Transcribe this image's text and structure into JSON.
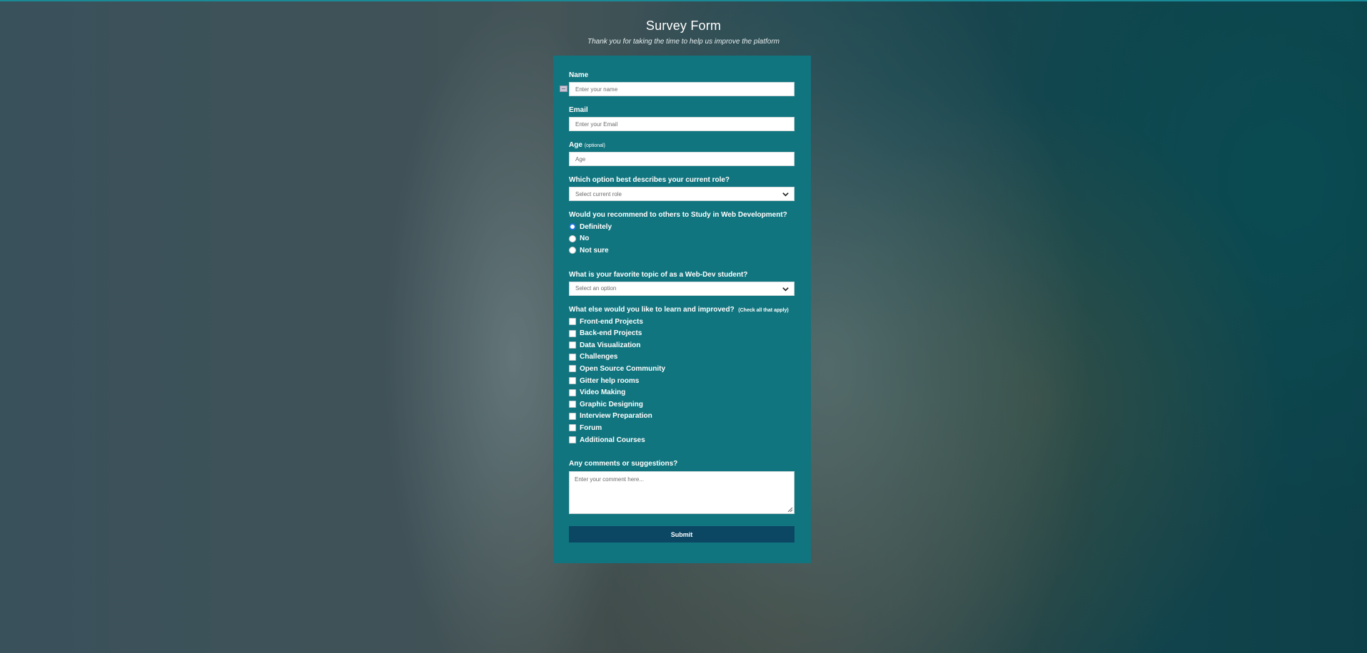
{
  "header": {
    "title": "Survey Form",
    "subtitle": "Thank you for taking the time to help us improve the platform"
  },
  "form": {
    "name": {
      "label": "Name",
      "placeholder": "Enter your name"
    },
    "email": {
      "label": "Email",
      "placeholder": "Enter your Email"
    },
    "age": {
      "label": "Age",
      "optional": "(optional)",
      "placeholder": "Age"
    },
    "role": {
      "label": "Which option best describes your current role?",
      "selected": "Select current role"
    },
    "recommend": {
      "label": "Would you recommend to others to Study in Web Development?",
      "options": [
        "Definitely",
        "No",
        "Not sure"
      ],
      "selected": "Definitely"
    },
    "topic": {
      "label": "What is your favorite topic of as a Web-Dev student?",
      "selected": "Select an option"
    },
    "improve": {
      "label": "What else would you like to learn and improved?",
      "hint": "(Check all that apply)",
      "options": [
        "Front-end Projects",
        "Back-end Projects",
        "Data Visualization",
        "Challenges",
        "Open Source Community",
        "Gitter help rooms",
        "Video Making",
        "Graphic Designing",
        "Interview Preparation",
        "Forum",
        "Additional Courses"
      ]
    },
    "comments": {
      "label": "Any comments or suggestions?",
      "placeholder": "Enter your comment here..."
    },
    "submit_label": "Submit"
  },
  "colors": {
    "form_bg": "#11757f",
    "submit_bg": "#0b4663",
    "radio_selected": "#1f73d6"
  }
}
